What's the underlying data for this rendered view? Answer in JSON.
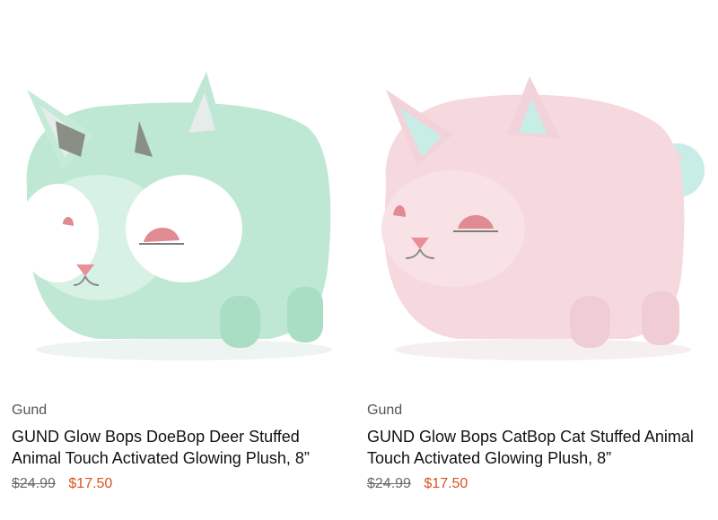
{
  "products": [
    {
      "brand": "Gund",
      "title": "GUND Glow Bops DoeBop Deer Stuffed Animal Touch Activated Glowing Plush, 8”",
      "old_price": "$24.99",
      "sale_price": "$17.50",
      "image": "green-deer-plush-image",
      "colors": {
        "body": "#bfe8d4",
        "accent": "#8fcfb3",
        "horn": "#8a8f86",
        "nose": "#e88f97"
      }
    },
    {
      "brand": "Gund",
      "title": "GUND Glow Bops CatBop Cat Stuffed Animal Touch Activated Glowing Plush, 8”",
      "old_price": "$24.99",
      "sale_price": "$17.50",
      "image": "pink-cat-plush-image",
      "colors": {
        "body": "#f6d9df",
        "accent": "#c8ece6",
        "nose": "#ea8e98"
      }
    }
  ],
  "colors": {
    "sale_price": "#d9531e",
    "old_price": "#6b6b6b",
    "title": "#111111"
  }
}
